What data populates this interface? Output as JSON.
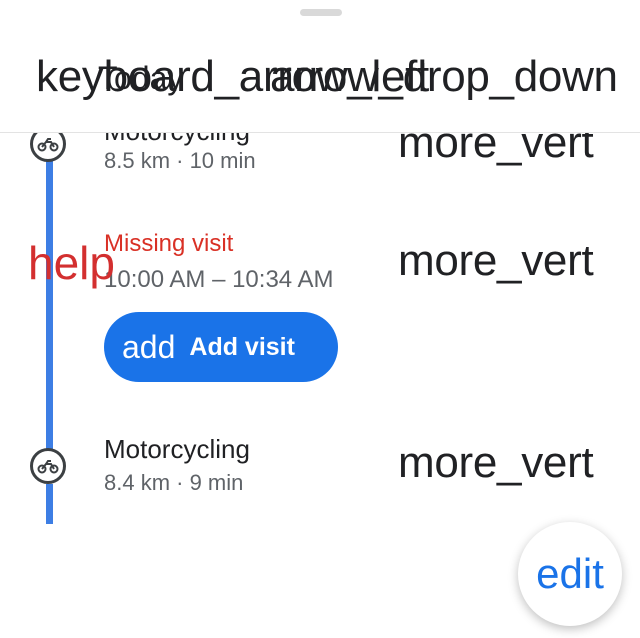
{
  "header": {
    "title": "Today",
    "back_icon_text": "keyboard_arrow_left",
    "dropdown_icon_text": "arrow_drop_down"
  },
  "timeline": {
    "accent": "#3d7ee4",
    "segments": [
      {
        "mode_icon": "motorcycle-icon",
        "title": "Motorcycling",
        "subtitle": "8.5 km · 10 min",
        "menu_icon_text": "more_vert"
      },
      {
        "mode_icon": "motorcycle-icon",
        "title": "Motorcycling",
        "subtitle": "8.4 km · 9 min",
        "menu_icon_text": "more_vert"
      }
    ],
    "missing_visit": {
      "status_icon_text": "help",
      "title": "Missing visit",
      "time": "10:00 AM – 10:34 AM",
      "menu_icon_text": "more_vert",
      "add_button": {
        "icon_text": "add",
        "label": "Add visit",
        "color": "#1a73e8"
      }
    }
  },
  "fab": {
    "icon_text": "edit",
    "color": "#1a73e8"
  }
}
